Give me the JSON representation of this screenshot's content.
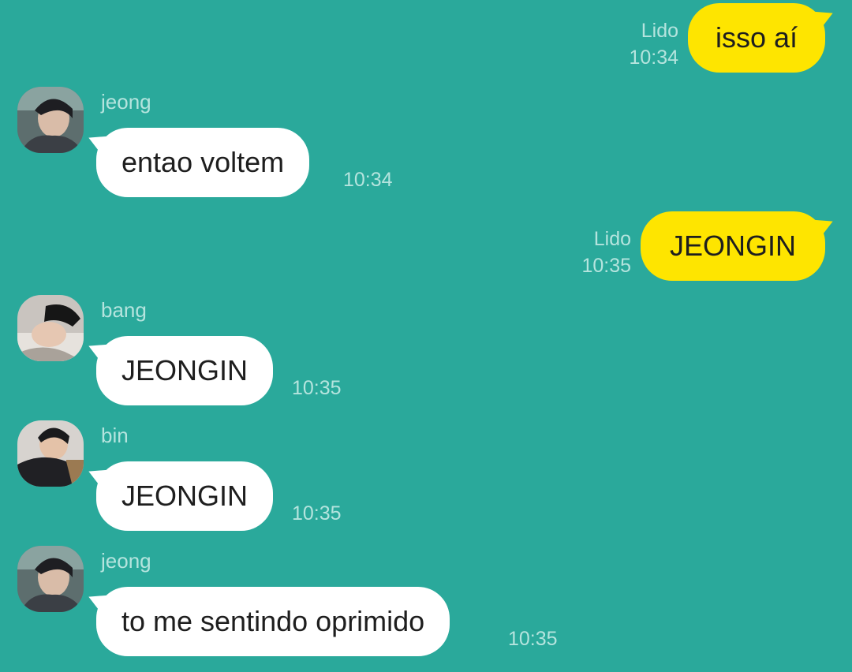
{
  "colors": {
    "background": "#2aa99b",
    "outgoing_bubble": "#fee500",
    "incoming_bubble": "#ffffff",
    "meta_text": "#b5e4de"
  },
  "messages": [
    {
      "direction": "outgoing",
      "status": "Lido",
      "time": "10:34",
      "text": "isso aí"
    },
    {
      "direction": "incoming",
      "sender": "jeong",
      "avatar": "jeong-avatar",
      "time": "10:34",
      "text": "entao voltem"
    },
    {
      "direction": "outgoing",
      "status": "Lido",
      "time": "10:35",
      "text": "JEONGIN"
    },
    {
      "direction": "incoming",
      "sender": "bang",
      "avatar": "bang-avatar",
      "time": "10:35",
      "text": "JEONGIN"
    },
    {
      "direction": "incoming",
      "sender": "bin",
      "avatar": "bin-avatar",
      "time": "10:35",
      "text": "JEONGIN"
    },
    {
      "direction": "incoming",
      "sender": "jeong",
      "avatar": "jeong-avatar",
      "time": "10:35",
      "text": "to me sentindo oprimido"
    }
  ]
}
